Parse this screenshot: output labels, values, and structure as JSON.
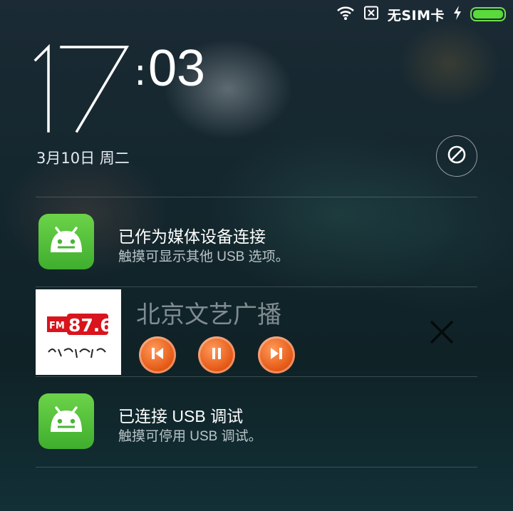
{
  "status_bar": {
    "wifi_icon": "wifi-icon",
    "sim_icon": "no-sim-icon",
    "carrier": "无SIM卡",
    "charging_icon": "lightning-icon",
    "battery_icon": "battery-icon",
    "battery_level": 1.0,
    "accent_color": "#59d93a"
  },
  "clock": {
    "hour": "17",
    "separator": ":",
    "minute": "03"
  },
  "date": "3月10日 周二",
  "dnd_icon": "do-not-disturb-icon",
  "notifications": [
    {
      "icon": "android-icon",
      "title": "已作为媒体设备连接",
      "subtitle": "触摸可显示其他 USB 选项。"
    },
    {
      "icon": "android-icon",
      "title": "已连接 USB 调试",
      "subtitle": "触摸可停用 USB 调试。"
    }
  ],
  "media": {
    "station": "北京文艺广播",
    "logo_text": "FM87.6",
    "logo_caption": "北京文艺广播",
    "controls": [
      "previous-icon",
      "pause-icon",
      "next-icon"
    ],
    "close_icon": "close-icon",
    "control_color": "#ec6018"
  }
}
